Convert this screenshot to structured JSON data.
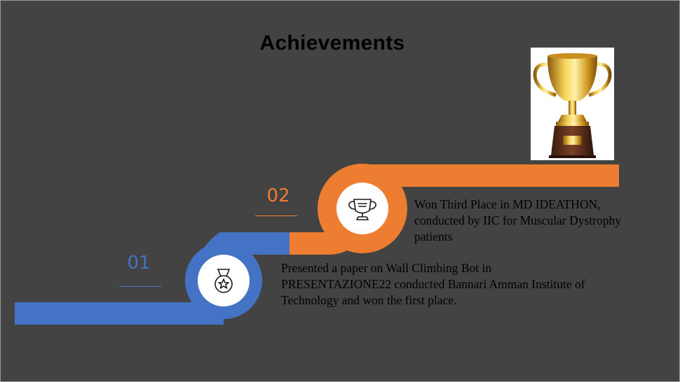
{
  "slide": {
    "title": "Achievements",
    "colors": {
      "background": "#434343",
      "step_1": "#4472c4",
      "step_2": "#ed7d31",
      "title": "#000000"
    }
  },
  "steps": [
    {
      "number": "01",
      "icon": "medal-icon",
      "text": "Presented a paper on Wall Climbing Bot in PRESENTAZIONE22 conducted Bannari Amman Institute of Technology and won the first place."
    },
    {
      "number": "02",
      "icon": "trophy-icon",
      "text": "Won Third Place in MD IDEATHON, conducted by IIC for Muscular Dystrophy patients"
    }
  ],
  "picture": {
    "icon": "gold-trophy-image"
  }
}
